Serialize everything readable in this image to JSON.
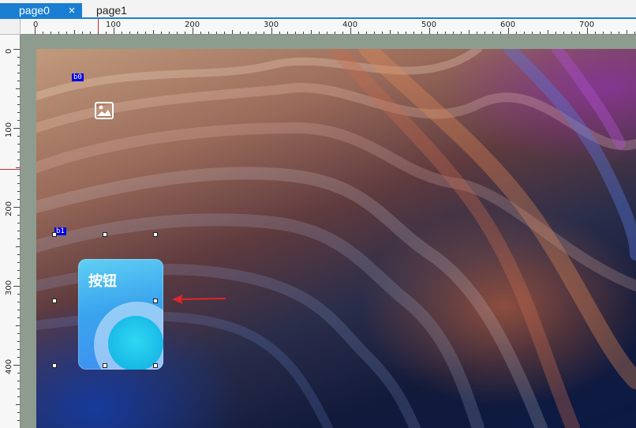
{
  "tabs": [
    {
      "label": "page0",
      "active": true
    },
    {
      "label": "page1",
      "active": false
    }
  ],
  "tab_close_glyph": "×",
  "ruler_top_labels": [
    "0",
    "100",
    "200",
    "300",
    "400",
    "500",
    "600",
    "700"
  ],
  "ruler_left_labels": [
    "0",
    "100",
    "200",
    "300",
    "400"
  ],
  "components": {
    "image": {
      "label": "b0",
      "icon": "image-icon"
    },
    "button": {
      "label": "b1",
      "text": "按钮"
    }
  },
  "colors": {
    "accent": "#1a7fd3",
    "component_label_bg": "#0000e0",
    "marker": "#d9232d",
    "workspace_bg": "#8d9c8e"
  }
}
